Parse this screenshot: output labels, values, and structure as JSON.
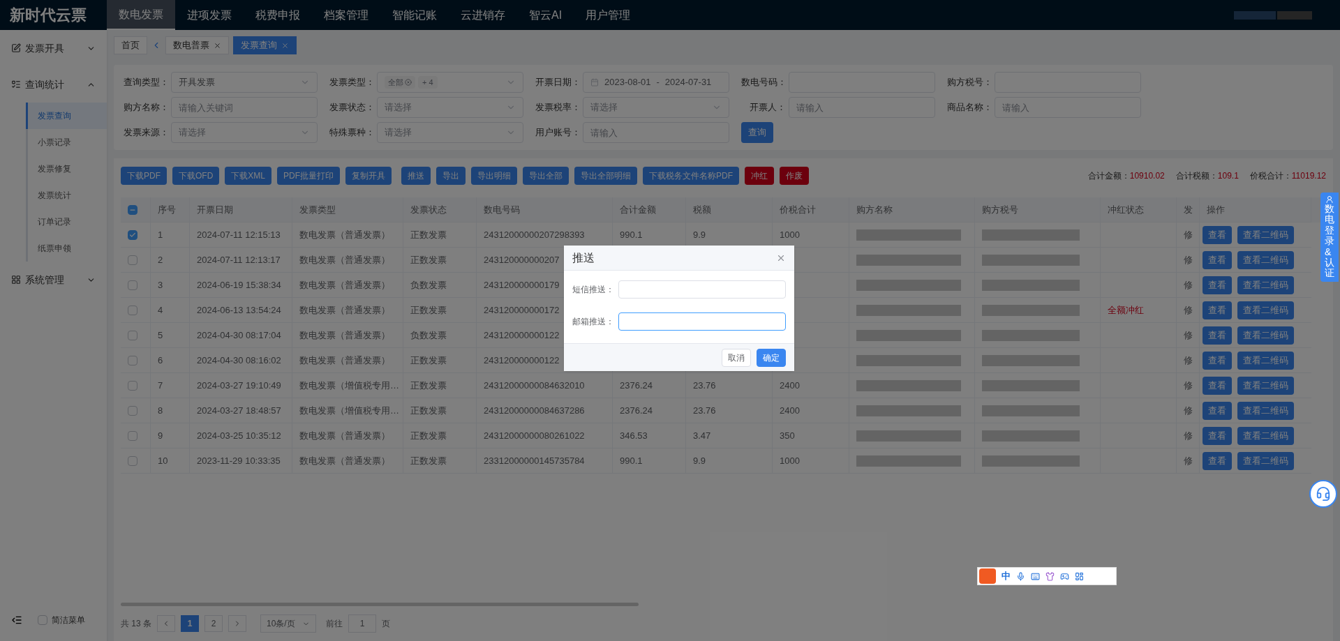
{
  "logo": "新时代云票",
  "nav": [
    {
      "label": "数电发票",
      "selected": true
    },
    {
      "label": "进项发票",
      "selected": false
    },
    {
      "label": "税费申报",
      "selected": false
    },
    {
      "label": "档案管理",
      "selected": false
    },
    {
      "label": "智能记账",
      "selected": false
    },
    {
      "label": "云进销存",
      "selected": false
    },
    {
      "label": "智云AI",
      "selected": false
    },
    {
      "label": "用户管理",
      "selected": false
    }
  ],
  "sidebar": {
    "items": [
      {
        "label": "发票开具",
        "expanded": false
      },
      {
        "label": "查询统计",
        "expanded": true,
        "children": [
          {
            "label": "发票查询",
            "selected": true
          },
          {
            "label": "小票记录",
            "selected": false
          },
          {
            "label": "发票修复",
            "selected": false
          },
          {
            "label": "发票统计",
            "selected": false
          },
          {
            "label": "订单记录",
            "selected": false
          },
          {
            "label": "纸票申领",
            "selected": false
          }
        ]
      },
      {
        "label": "系统管理",
        "expanded": false
      }
    ],
    "simple_menu": {
      "label": "简洁菜单",
      "checked": false
    }
  },
  "page_tabs": {
    "home": "首页",
    "tabs": [
      {
        "label": "数电普票",
        "selected": false
      },
      {
        "label": "发票查询",
        "selected": true
      }
    ]
  },
  "filters": [
    {
      "kind": "select",
      "label": "查询类型：",
      "value": "开具发票"
    },
    {
      "kind": "tags",
      "label": "发票类型：",
      "tags": [
        "全部"
      ],
      "more": "+ 4"
    },
    {
      "kind": "date",
      "label": "开票日期：",
      "start": "2023-08-01",
      "sep": "-",
      "end": "2024-07-31"
    },
    {
      "kind": "input",
      "label": "数电号码："
    },
    {
      "kind": "input",
      "label": "购方税号："
    },
    {
      "kind": "input",
      "label": "购方名称：",
      "placeholder": "请输入关键词"
    },
    {
      "kind": "select",
      "label": "发票状态：",
      "placeholder": "请选择"
    },
    {
      "kind": "select",
      "label": "发票税率：",
      "placeholder": "请选择"
    },
    {
      "kind": "input",
      "label": "开票人：",
      "placeholder": "请输入"
    },
    {
      "kind": "input",
      "label": "商品名称：",
      "placeholder": "请输入"
    },
    {
      "kind": "select",
      "label": "发票来源：",
      "placeholder": "请选择"
    },
    {
      "kind": "select",
      "label": "特殊票种：",
      "placeholder": "请选择"
    },
    {
      "kind": "input",
      "label": "用户账号：",
      "placeholder": "请输入"
    },
    {
      "kind": "button",
      "label": "查询"
    }
  ],
  "actions": [
    {
      "label": "下载PDF",
      "kind": "primary"
    },
    {
      "label": "下载OFD",
      "kind": "primary"
    },
    {
      "label": "下载XML",
      "kind": "primary"
    },
    {
      "label": "PDF批量打印",
      "kind": "primary"
    },
    {
      "label": "复制开具",
      "kind": "primary"
    },
    {
      "label": "推送",
      "kind": "primary"
    },
    {
      "label": "导出",
      "kind": "primary"
    },
    {
      "label": "导出明细",
      "kind": "primary"
    },
    {
      "label": "导出全部",
      "kind": "primary"
    },
    {
      "label": "导出全部明细",
      "kind": "primary"
    },
    {
      "label": "下载税务文件名称PDF",
      "kind": "primary"
    },
    {
      "label": "冲红",
      "kind": "danger"
    },
    {
      "label": "作废",
      "kind": "danger"
    }
  ],
  "totals": [
    {
      "label": "合计金额：",
      "value": "10910.02"
    },
    {
      "label": "合计税额：",
      "value": "109.1"
    },
    {
      "label": "价税合计：",
      "value": "11019.12"
    }
  ],
  "table": {
    "header_checkbox": {
      "indeterminate": true
    },
    "columns": [
      "序号",
      "开票日期",
      "发票类型",
      "发票状态",
      "数电号码",
      "合计金额",
      "税额",
      "价税合计",
      "购方名称",
      "购方税号",
      "冲红状态",
      "发",
      "操作"
    ],
    "rows": [
      {
        "checked": true,
        "no": "1",
        "date": "2024-07-11 12:15:13",
        "type": "数电发票（普通发票）",
        "status": "正数发票",
        "number": "24312000000207298393",
        "amount": "990.1",
        "tax": "9.9",
        "total": "1000",
        "fix": "修",
        "buttons": [
          "查看",
          "查看二维码"
        ]
      },
      {
        "checked": false,
        "no": "2",
        "date": "2024-07-11 12:13:17",
        "type": "数电发票（普通发票）",
        "status": "正数发票",
        "number": "243120000000207",
        "fix": "修",
        "buttons": [
          "查看",
          "查看二维码"
        ]
      },
      {
        "checked": false,
        "no": "3",
        "date": "2024-06-19 15:38:34",
        "type": "数电发票（普通发票）",
        "status": "负数发票",
        "number": "243120000000179",
        "fix": "修",
        "buttons": [
          "查看",
          "查看二维码"
        ]
      },
      {
        "checked": false,
        "no": "4",
        "date": "2024-06-13 13:54:24",
        "type": "数电发票（普通发票）",
        "status": "正数发票",
        "number": "243120000000172",
        "red": "全额冲红",
        "fix": "修",
        "buttons": [
          "查看",
          "查看二维码"
        ]
      },
      {
        "checked": false,
        "no": "5",
        "date": "2024-04-30 08:17:04",
        "type": "数电发票（普通发票）",
        "status": "负数发票",
        "number": "243120000000122",
        "fix": "修",
        "buttons": [
          "查看",
          "查看二维码"
        ]
      },
      {
        "checked": false,
        "no": "6",
        "date": "2024-04-30 08:16:02",
        "type": "数电发票（普通发票）",
        "status": "正数发票",
        "number": "243120000000122",
        "fix": "修",
        "buttons": [
          "查看",
          "查看二维码"
        ]
      },
      {
        "checked": false,
        "no": "7",
        "date": "2024-03-27 19:10:49",
        "type": "数电发票（增值税专用…",
        "status": "正数发票",
        "number": "24312000000084632010",
        "amount": "2376.24",
        "tax": "23.76",
        "total": "2400",
        "fix": "修",
        "buttons": [
          "查看",
          "查看二维码"
        ]
      },
      {
        "checked": false,
        "no": "8",
        "date": "2024-03-27 18:48:57",
        "type": "数电发票（增值税专用…",
        "status": "正数发票",
        "number": "24312000000084637286",
        "amount": "2376.24",
        "tax": "23.76",
        "total": "2400",
        "fix": "修",
        "buttons": [
          "查看",
          "查看二维码"
        ]
      },
      {
        "checked": false,
        "no": "9",
        "date": "2024-03-25 10:35:12",
        "type": "数电发票（普通发票）",
        "status": "正数发票",
        "number": "24312000000080261022",
        "amount": "346.53",
        "tax": "3.47",
        "total": "350",
        "fix": "修",
        "buttons": [
          "查看",
          "查看二维码"
        ]
      },
      {
        "checked": false,
        "no": "10",
        "date": "2023-11-29 10:33:35",
        "type": "数电发票（普通发票）",
        "status": "正数发票",
        "number": "23312000000145735784",
        "amount": "990.1",
        "tax": "9.9",
        "total": "1000",
        "fix": "修",
        "buttons": [
          "查看",
          "查看二维码"
        ]
      }
    ]
  },
  "pagination": {
    "total": "共 13 条",
    "pages": [
      {
        "label": "1",
        "selected": true
      },
      {
        "label": "2",
        "selected": false
      }
    ],
    "size": "10条/页",
    "goto": "前往",
    "goto_value": "1",
    "page_unit": "页"
  },
  "side_tab": "数电登录&认证",
  "ime": {
    "mode": "中"
  },
  "dialog": {
    "title": "推送",
    "fields": [
      {
        "label": "短信推送：",
        "focused": false
      },
      {
        "label": "邮箱推送：",
        "focused": true
      }
    ],
    "buttons": [
      {
        "label": "取消",
        "kind": "default"
      },
      {
        "label": "确定",
        "kind": "primary"
      }
    ]
  }
}
